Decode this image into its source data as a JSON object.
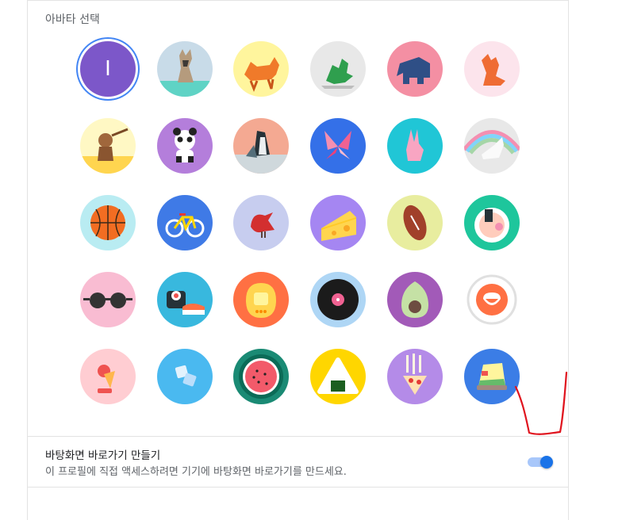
{
  "section_title": "아바타 선택",
  "selected_avatar_letter": "I",
  "avatars": [
    {
      "name": "letter-i",
      "bg": "#7c57c9"
    },
    {
      "name": "origami-cat",
      "bg": "#c8dbe8"
    },
    {
      "name": "origami-fox-corgi",
      "bg": "#fff59d"
    },
    {
      "name": "origami-dragon",
      "bg": "#e8e8e8"
    },
    {
      "name": "origami-elephant",
      "bg": "#f48fa3"
    },
    {
      "name": "origami-fox",
      "bg": "#fce4ec"
    },
    {
      "name": "origami-monkey",
      "bg": "#fff8c4"
    },
    {
      "name": "origami-panda",
      "bg": "#b47edb"
    },
    {
      "name": "origami-penguin",
      "bg": "#f4a992"
    },
    {
      "name": "origami-butterfly",
      "bg": "#3470e8"
    },
    {
      "name": "origami-rabbit",
      "bg": "#20c6d6"
    },
    {
      "name": "origami-unicorn",
      "bg": "#e8e8e8"
    },
    {
      "name": "basketball",
      "bg": "#b9ecf2"
    },
    {
      "name": "bicycle",
      "bg": "#3f7ae6"
    },
    {
      "name": "bird",
      "bg": "#c7cdef"
    },
    {
      "name": "cheese",
      "bg": "#a586f2"
    },
    {
      "name": "football",
      "bg": "#e8ed9f"
    },
    {
      "name": "sushi-bowl",
      "bg": "#1ec69c"
    },
    {
      "name": "sunglasses",
      "bg": "#f9bcd2"
    },
    {
      "name": "sushi-roll",
      "bg": "#38b8de"
    },
    {
      "name": "tamagotchi",
      "bg": "#ff7043"
    },
    {
      "name": "vinyl-record",
      "bg": "#aed6f5"
    },
    {
      "name": "avocado",
      "bg": "#a25ab8"
    },
    {
      "name": "smile-face",
      "bg": "#ffffff"
    },
    {
      "name": "ice-cream",
      "bg": "#ffcdd2"
    },
    {
      "name": "ice-cubes",
      "bg": "#4ab9f0"
    },
    {
      "name": "watermelon",
      "bg": "#1a8a74"
    },
    {
      "name": "onigiri",
      "bg": "#ffd600"
    },
    {
      "name": "pizza",
      "bg": "#b48be8"
    },
    {
      "name": "sandwich",
      "bg": "#3b7de6"
    }
  ],
  "shortcut": {
    "title": "바탕화면 바로가기 만들기",
    "description": "이 프로필에 직접 액세스하려면 기기에 바탕화면 바로가기를 만드세요.",
    "enabled": true
  }
}
